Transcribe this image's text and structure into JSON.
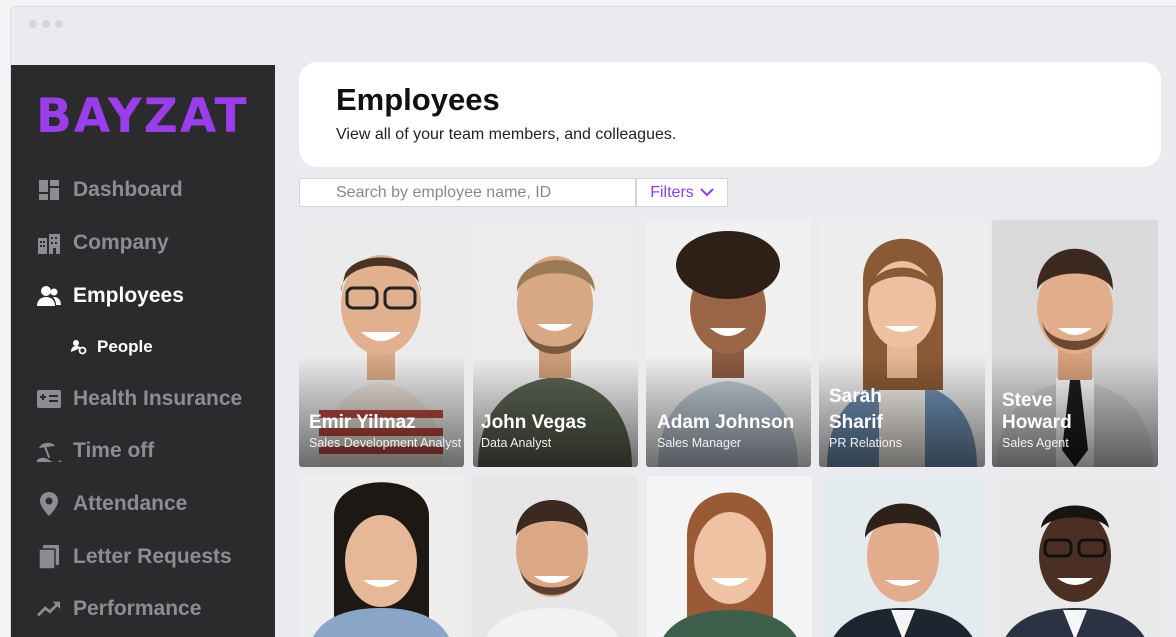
{
  "brand": {
    "logo_text": "BAYZAT",
    "accent": "#9a3dea"
  },
  "sidebar": {
    "items": [
      {
        "label": "Dashboard",
        "icon": "dashboard-icon"
      },
      {
        "label": "Company",
        "icon": "building-icon"
      },
      {
        "label": "Employees",
        "icon": "users-icon",
        "active": true
      },
      {
        "label": "People",
        "icon": "person-settings-icon",
        "sub": true
      },
      {
        "label": "Health Insurance",
        "icon": "insurance-card-icon"
      },
      {
        "label": "Time off",
        "icon": "beach-icon"
      },
      {
        "label": "Attendance",
        "icon": "location-pin-icon"
      },
      {
        "label": "Letter Requests",
        "icon": "document-icon"
      },
      {
        "label": "Performance",
        "icon": "trend-arrow-icon"
      }
    ]
  },
  "header": {
    "title": "Employees",
    "subtitle": "View all of your team members, and colleagues."
  },
  "search": {
    "placeholder": "Search by employee name, ID",
    "value": ""
  },
  "filters": {
    "label": "Filters"
  },
  "employees": [
    {
      "name": "Emir Yilmaz",
      "role": "Sales Development Analyst"
    },
    {
      "name": "John Vegas",
      "role": "Data Analyst"
    },
    {
      "name": "Adam Johnson",
      "role": "Sales Manager"
    },
    {
      "name": "Sarah Sharif",
      "name_line1": "Sarah",
      "name_line2": "Sharif",
      "role": "PR Relations"
    },
    {
      "name": "Steve Howard",
      "name_line1": "Steve",
      "name_line2": "Howard",
      "role": "Sales Agent"
    },
    {
      "name": "",
      "role": ""
    },
    {
      "name": "",
      "role": ""
    },
    {
      "name": "",
      "role": ""
    },
    {
      "name": "",
      "role": ""
    },
    {
      "name": "",
      "role": ""
    }
  ]
}
